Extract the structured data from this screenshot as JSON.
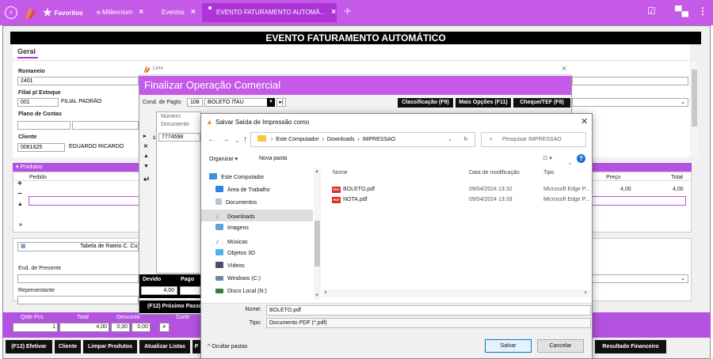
{
  "browser": {
    "tabs": [
      {
        "label": "Favoritos"
      },
      {
        "label": "e-Millennium"
      },
      {
        "label": "Eventos"
      },
      {
        "label": "EVENTO FATURAMENTO AUTOMÁ..."
      }
    ]
  },
  "page": {
    "title": "EVENTO FATURAMENTO AUTOMÁTICO",
    "geral_tab": "Geral",
    "romaneio": {
      "label": "Romaneio",
      "value": "2401"
    },
    "filial": {
      "label": "Filial p/ Estoque",
      "code": "001",
      "name": "FILIAL PADRÃO"
    },
    "plano": {
      "label": "Plano de Contas"
    },
    "cliente": {
      "label": "Cliente",
      "code": "0061625",
      "name": "EDUARDO RICARDO"
    },
    "produtos": {
      "header": "Produtos",
      "col_pedido": "Pedido",
      "col_preco": "Preço",
      "col_total": "Total",
      "row_preco": "4,00",
      "row_total": "4,00"
    },
    "lower": {
      "rateio": "Tabela de Rateio C. Cu",
      "presente": "End. de Presente",
      "representante": "Representante"
    },
    "totals": {
      "qtde_label": "Qtde Pcs",
      "total_label": "Total",
      "desconto_label": "Desconto",
      "cortesia_label": "Corte",
      "qtde": "1",
      "total": "4,00",
      "desc1": "0,00",
      "desc2": "0,00"
    },
    "buttons": {
      "efetivar": "(F12) Efetivar",
      "cliente": "Cliente",
      "limpar": "Limpar Produtos",
      "atualizar": "Atualizar Listas",
      "p": "P",
      "resultado": "Resultado Financeiro"
    }
  },
  "linx": {
    "window_title": "Linx",
    "header": "Finalizar Operação Comercial",
    "cond_label": "Cond. de Pagto",
    "cond_code": "108",
    "cond_name": "BOLETO ITAU",
    "btn_class": "Classificação (F9)",
    "btn_mais": "Mais Opções (F11)",
    "btn_cheque": "Cheque/TEF (F8)",
    "grid_col": "Número Documento",
    "grid_value": "7774598",
    "grid_rownum": "1",
    "devido_label": "Devido",
    "pago_label": "Pago",
    "devido_value": "4,00",
    "next": "(F12) Próximo Passo"
  },
  "save_dialog": {
    "title": "Salvar Saída de Impressão como",
    "path": [
      "Este Computador",
      "Downloads",
      "IMPRESSAO"
    ],
    "search_placeholder": "Pesquisar IMPRESSAO",
    "organizar": "Organizar ▾",
    "nova_pasta": "Nova pasta",
    "nav": [
      {
        "label": "Este Computador",
        "icon": "computer-icon"
      },
      {
        "label": "Área de Trabalho",
        "icon": "desktop-icon"
      },
      {
        "label": "Documentos",
        "icon": "documents-icon"
      },
      {
        "label": "Downloads",
        "icon": "downloads-icon"
      },
      {
        "label": "Imagens",
        "icon": "images-icon"
      },
      {
        "label": "Músicas",
        "icon": "music-icon"
      },
      {
        "label": "Objetos 3D",
        "icon": "3d-objects-icon"
      },
      {
        "label": "Vídeos",
        "icon": "videos-icon"
      },
      {
        "label": "Windows (C:)",
        "icon": "drive-icon"
      },
      {
        "label": "Disco Local (N:)",
        "icon": "drive-icon"
      }
    ],
    "columns": {
      "name": "Nome",
      "date": "Data de modificação",
      "type": "Tipo"
    },
    "files": [
      {
        "name": "BOLETO.pdf",
        "date": "09/04/2024 13:32",
        "type": "Microsoft Edge P..."
      },
      {
        "name": "NOTA.pdf",
        "date": "09/04/2024 13:33",
        "type": "Microsoft Edge P..."
      }
    ],
    "filename_label": "Nome:",
    "filename_value": "BOLETO.pdf",
    "filetype_label": "Tipo:",
    "filetype_value": "Documento PDF (*.pdf)",
    "hide_folders": "Ocultar pastas",
    "save_btn": "Salvar",
    "cancel_btn": "Cancelar"
  }
}
